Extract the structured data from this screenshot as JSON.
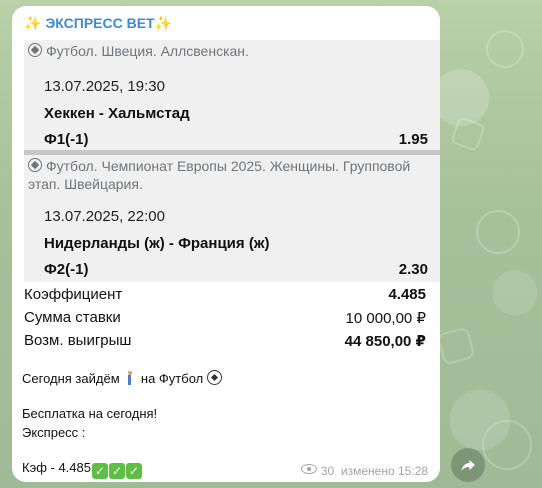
{
  "channel_title": "✨ ЭКСПРЕСС ВЕТ✨",
  "events": [
    {
      "sport_line": "Футбол. Швеция. Аллсвенскан.",
      "datetime": "13.07.2025, 19:30",
      "teams": "Хеккен - Хальмстад",
      "bet": "Ф1(-1)",
      "odd": "1.95"
    },
    {
      "sport_line": "Футбол. Чемпионат Европы 2025. Женщины. Групповой этап. Швейцария.",
      "datetime": "13.07.2025, 22:00",
      "teams": "Нидерланды (ж) - Франция (ж)",
      "bet": "Ф2(-1)",
      "odd": "2.30"
    }
  ],
  "summary": {
    "coef_label": "Коэффициент",
    "coef_value": "4.485",
    "stake_label": "Сумма ставки",
    "stake_value": "10 000,00 ₽",
    "win_label": "Возм. выигрыш",
    "win_value": "44 850,00 ₽"
  },
  "message": {
    "line1_prefix": "Сегодня зайдём",
    "line1_suffix": "на Футбол",
    "line2": "Бесплатка на сегодня!",
    "line3": "Экспресс :",
    "line4": "Кэф - 4.485"
  },
  "meta": {
    "views": "30",
    "edited": "изменено 15:28"
  },
  "colors": {
    "accent": "#3d8bd4",
    "check": "#5fbf45"
  },
  "icons": [
    "soccer-ball-icon",
    "runner-emoji-icon",
    "check-mark-icon",
    "eye-icon",
    "share-arrow-icon"
  ]
}
